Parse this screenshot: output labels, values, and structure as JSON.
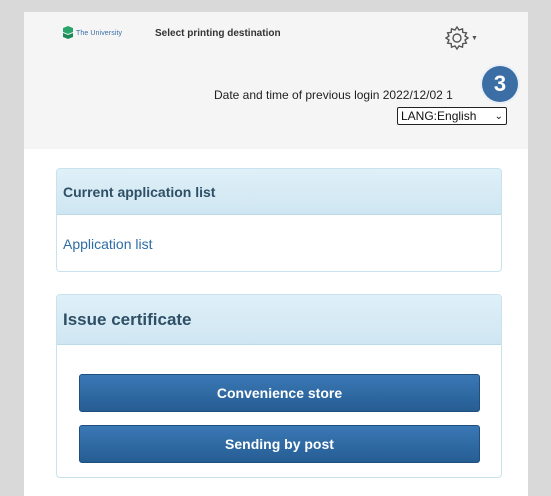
{
  "header": {
    "logo_text": "The University",
    "title": "Select printing destination",
    "login_info": "Date and time of previous login 2022/12/02 1",
    "language_select": "LANG:English",
    "icon": "gear-icon"
  },
  "badge": {
    "number": "3"
  },
  "panels": {
    "current_list": {
      "title": "Current application list",
      "link": "Application list"
    },
    "issue": {
      "title": "Issue certificate",
      "buttons": [
        "Convenience store",
        "Sending by post"
      ]
    }
  },
  "colors": {
    "accent": "#2e6da4",
    "button": "#2b649c",
    "panel_header": "#d6ebf5",
    "badge": "#3b6ea5"
  }
}
